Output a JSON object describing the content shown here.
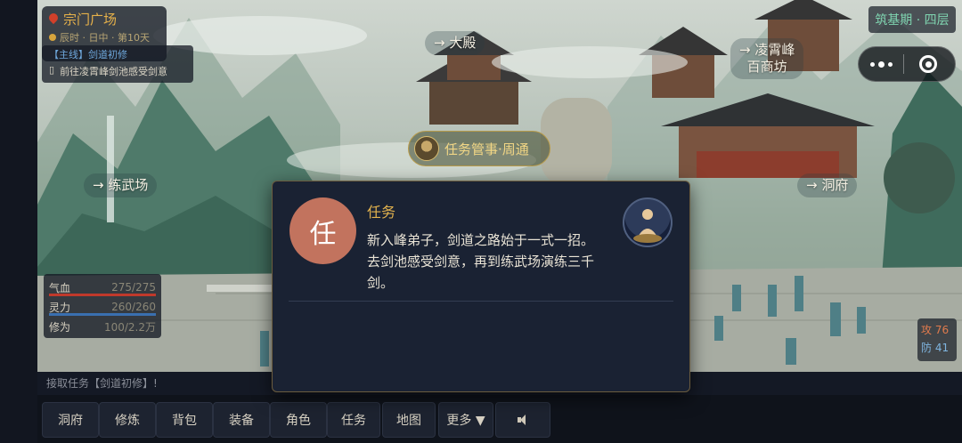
{
  "location": {
    "name": "宗门广场",
    "time": "辰时 · 日中 · 第10天",
    "icon": "map-pin-icon"
  },
  "main_quest": {
    "tag": "【主线】剑道初修",
    "objective": "前往凌霄峰剑池感受剑意"
  },
  "realm": "筑基期 · 四层",
  "scene_nav": {
    "north": "→ 大殿",
    "northeast_line1": "→ 凌霄峰",
    "northeast_line2": "百商坊",
    "west": "→ 练武场",
    "east": "→ 洞府"
  },
  "npc": {
    "label": "任务管事·周通"
  },
  "stats": {
    "hp_label": "气血",
    "hp_value": "275/275",
    "hp_fraction": 1.0,
    "hp_color": "#c0392b",
    "mp_label": "灵力",
    "mp_value": "260/260",
    "mp_fraction": 1.0,
    "mp_color": "#3a6fb0",
    "cult_label": "修为",
    "cult_value": "100/2.2万",
    "cult_fraction": 0.005
  },
  "combat": {
    "atk": "攻 76",
    "def": "防 41"
  },
  "log_line": "接取任务【剑道初修】!",
  "menu": {
    "items": [
      "洞府",
      "修炼",
      "背包",
      "装备",
      "角色",
      "任务",
      "地图",
      "更多 ▼"
    ],
    "sound_icon": "speaker-icon"
  },
  "modal": {
    "seal_char": "任",
    "title": "任务",
    "text": "新入峰弟子，剑道之路始于一式一招。去剑池感受剑意，再到练武场演练三千剑。",
    "portrait_icon": "meditating-cultivator-icon"
  },
  "colors": {
    "accent_gold": "#e3b34e",
    "realm_green": "#7fd4b0",
    "seal_red": "#c2735e"
  }
}
